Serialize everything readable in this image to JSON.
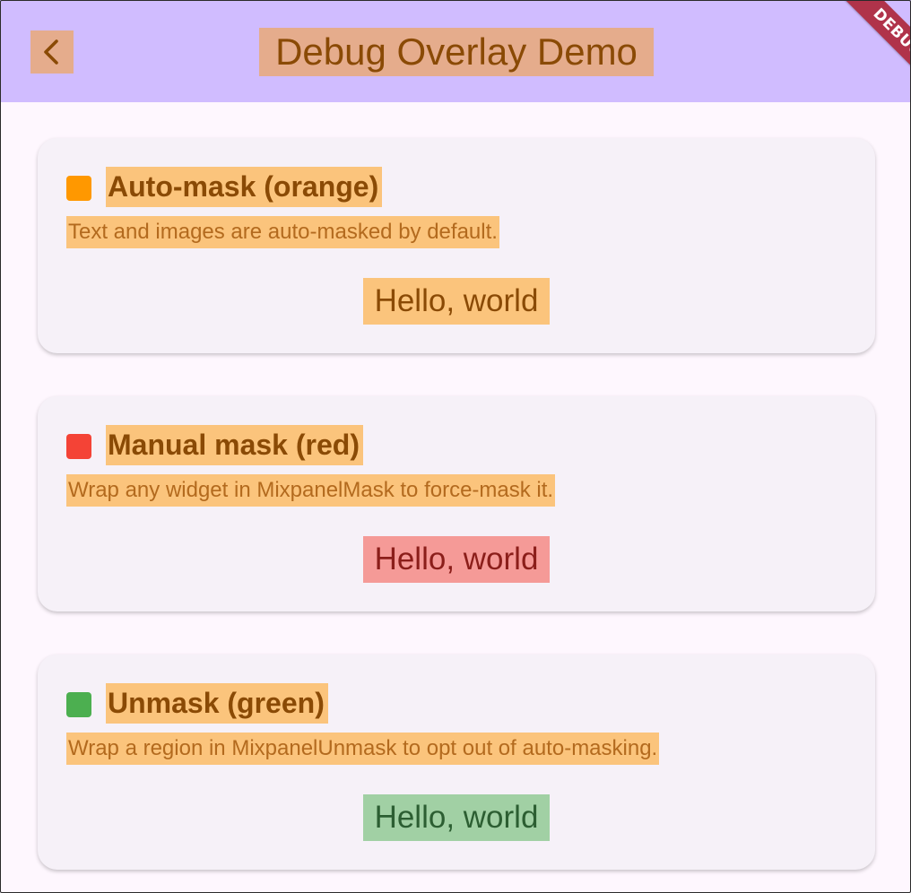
{
  "appbar": {
    "title": "Debug Overlay Demo",
    "back_icon": "chevron-left-icon",
    "background": "#D0BCFF"
  },
  "debug_banner": {
    "label": "DEBUG",
    "color": "#B0334A"
  },
  "overlay_colors": {
    "auto": "#FF9800",
    "manual": "#F44336",
    "unmask": "#4CAF50"
  },
  "cards": [
    {
      "title": "Auto-mask (orange)",
      "description": "Text and images are auto-masked by default.",
      "sample": "Hello, world",
      "swatch_color": "#FF9800"
    },
    {
      "title": "Manual mask (red)",
      "description": "Wrap any widget in MixpanelMask to force-mask it.",
      "sample": "Hello, world",
      "swatch_color": "#F44336"
    },
    {
      "title": "Unmask (green)",
      "description": "Wrap a region in MixpanelUnmask to opt out of auto-masking.",
      "sample": "Hello, world",
      "swatch_color": "#4CAF50"
    }
  ]
}
